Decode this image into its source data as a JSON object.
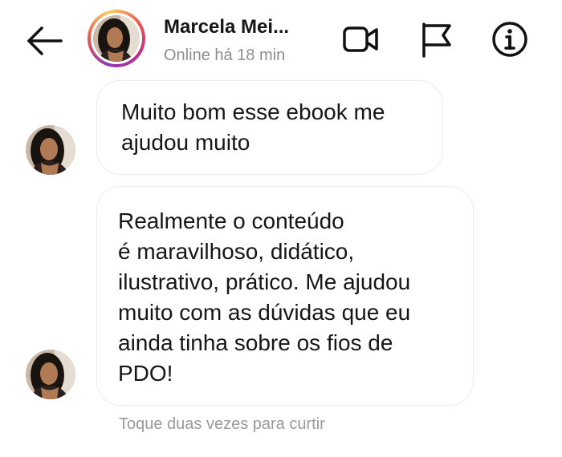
{
  "header": {
    "contact_name": "Marcela Mei...",
    "status": "Online há 18 min",
    "icons": {
      "back": "back-arrow-icon",
      "video": "video-camera-icon",
      "flag": "flag-icon",
      "info": "info-icon"
    },
    "story_ring_colors": [
      "#8a3ab9",
      "#e95950",
      "#fccc63",
      "#bc2a8d"
    ]
  },
  "messages": [
    {
      "text": "Muito bom esse ebook me\najudou muito"
    },
    {
      "text": "Realmente o conteúdo\né maravilhoso, didático,\nilustrativo, prático. Me ajudou\nmuito com as dúvidas que eu\nainda tinha sobre os fios de\nPDO!"
    }
  ],
  "hint": "Toque duas vezes para curtir"
}
